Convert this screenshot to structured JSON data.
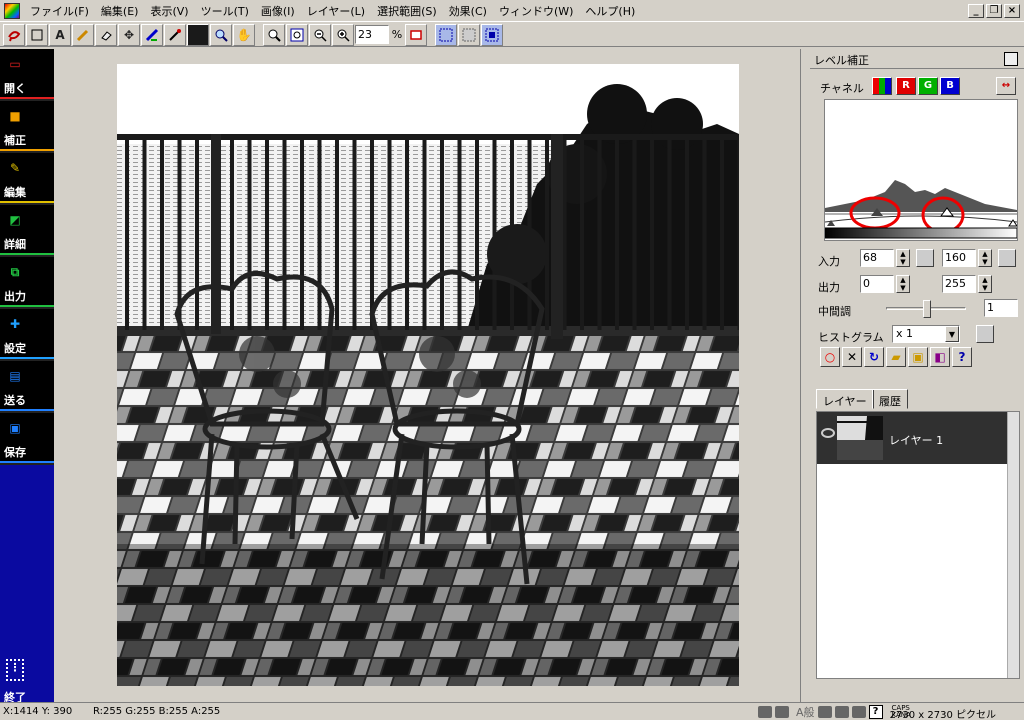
{
  "menu": {
    "items": [
      "ファイル(F)",
      "編集(E)",
      "表示(V)",
      "ツール(T)",
      "画像(I)",
      "レイヤー(L)",
      "選択範囲(S)",
      "効果(C)",
      "ウィンドウ(W)",
      "ヘルプ(H)"
    ]
  },
  "window_controls": {
    "minimize": "_",
    "restore": "❐",
    "close": "×"
  },
  "toolbar": {
    "zoom_value": "23",
    "zoom_unit": "%"
  },
  "sidebar": {
    "items": [
      {
        "label": "開く",
        "icon": "open-icon",
        "color": "#e02020"
      },
      {
        "label": "補正",
        "icon": "correct-icon",
        "color": "#f0a000"
      },
      {
        "label": "編集",
        "icon": "edit-icon",
        "color": "#e0c000"
      },
      {
        "label": "詳細",
        "icon": "detail-icon",
        "color": "#20c040"
      },
      {
        "label": "出力",
        "icon": "output-icon",
        "color": "#20c040"
      },
      {
        "label": "設定",
        "icon": "settings-icon",
        "color": "#20a0ff"
      },
      {
        "label": "送る",
        "icon": "send-icon",
        "color": "#2080ff"
      },
      {
        "label": "保存",
        "icon": "save-icon",
        "color": "#2080ff"
      }
    ],
    "exit_label": "終了"
  },
  "levels": {
    "title": "レベル補正",
    "channel_label": "チャネル",
    "channels": [
      "",
      "R",
      "G",
      "B"
    ],
    "input_label": "入力",
    "input_low": "68",
    "input_high": "160",
    "output_label": "出力",
    "output_low": "0",
    "output_high": "255",
    "midtone_label": "中間調",
    "midtone_value": "1",
    "histogram_label": "ヒストグラム",
    "histogram_scale": "x 1"
  },
  "layers": {
    "tabs": [
      "レイヤー",
      "履歴"
    ],
    "layer_name": "レイヤー 1"
  },
  "status": {
    "coords": "X:1414 Y: 390",
    "rgba": "R:255 G:255 B:255 A:255",
    "ime": "A般",
    "caps": "CAPS",
    "kana": "KANA",
    "size": "2730 x 2730 ピクセル"
  }
}
